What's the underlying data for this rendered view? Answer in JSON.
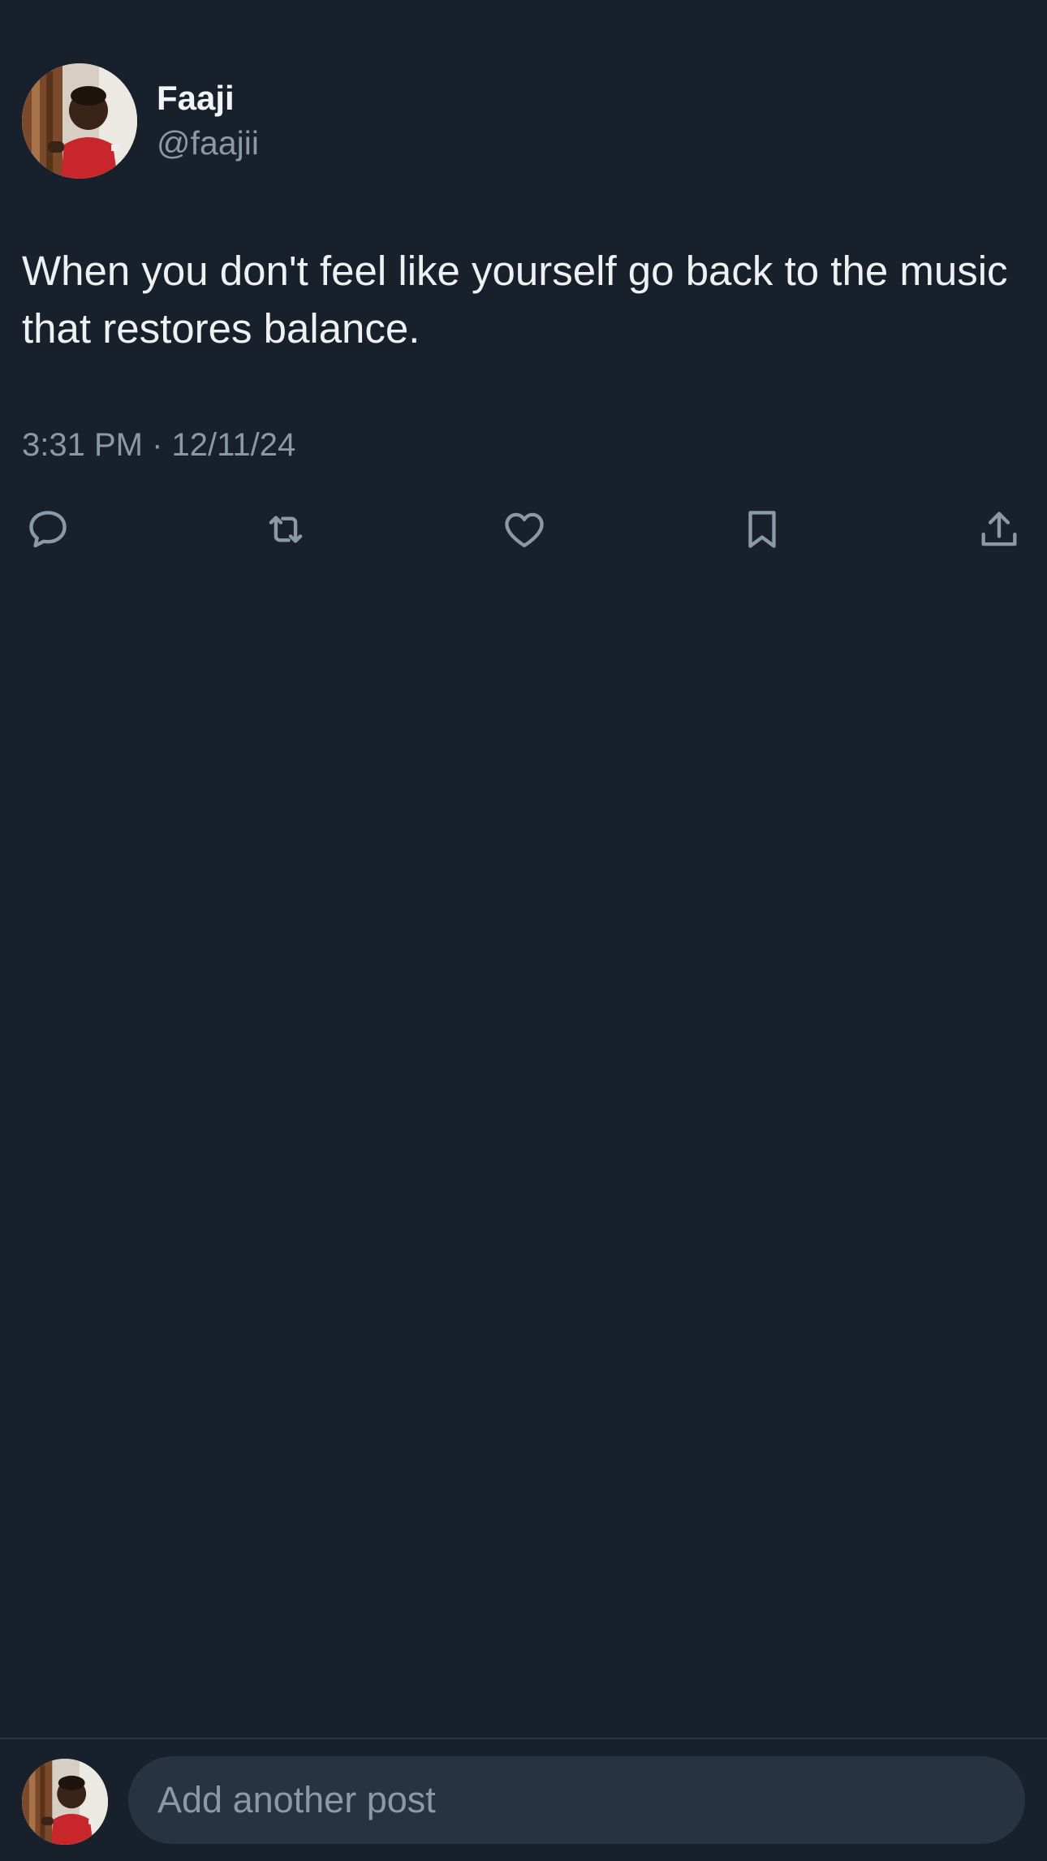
{
  "post": {
    "author": {
      "display_name": "Faaji",
      "handle": "@faajii"
    },
    "text": "When you don't feel like yourself go back to the music that restores balance.",
    "timestamp": "3:31 PM · 12/11/24"
  },
  "actions": [
    {
      "name": "reply",
      "icon": "speech-bubble-icon"
    },
    {
      "name": "repost",
      "icon": "repost-arrows-icon"
    },
    {
      "name": "like",
      "icon": "heart-icon"
    },
    {
      "name": "bookmark",
      "icon": "bookmark-icon"
    },
    {
      "name": "share",
      "icon": "share-upload-icon"
    }
  ],
  "composer": {
    "placeholder": "Add another post"
  },
  "colors": {
    "background": "#18202b",
    "primary_text": "#e7e9ea",
    "secondary_text": "#8b98a5",
    "input_background": "#283341",
    "icon": "#8b98a5"
  }
}
